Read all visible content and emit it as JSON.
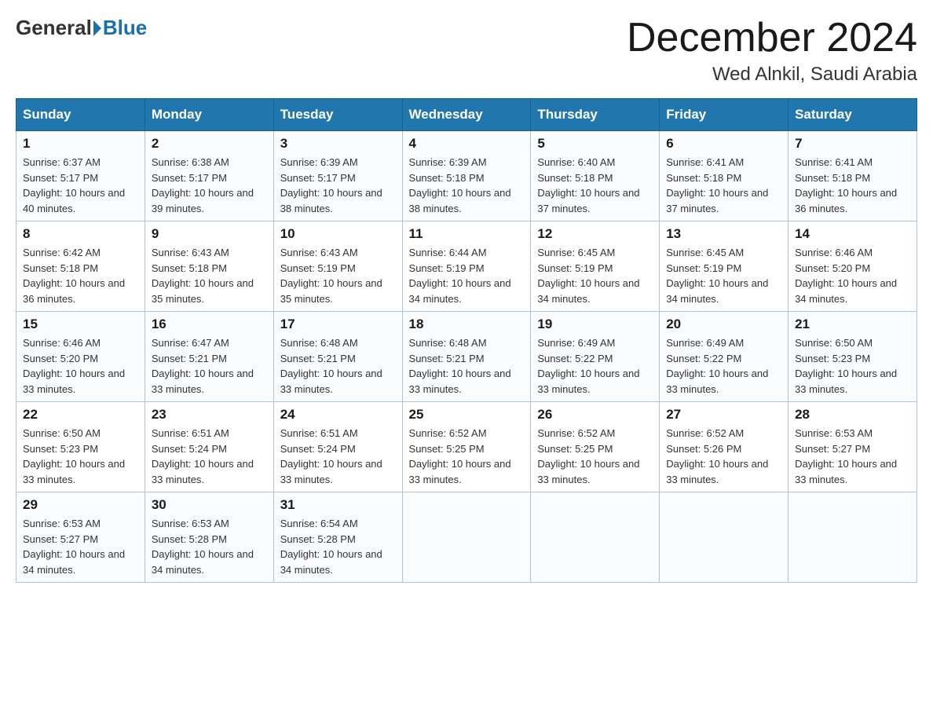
{
  "header": {
    "logo": {
      "part1": "General",
      "part2": "Blue"
    },
    "title": "December 2024",
    "subtitle": "Wed Alnkil, Saudi Arabia"
  },
  "days_of_week": [
    "Sunday",
    "Monday",
    "Tuesday",
    "Wednesday",
    "Thursday",
    "Friday",
    "Saturday"
  ],
  "weeks": [
    [
      {
        "day": "1",
        "sunrise": "6:37 AM",
        "sunset": "5:17 PM",
        "daylight": "10 hours and 40 minutes."
      },
      {
        "day": "2",
        "sunrise": "6:38 AM",
        "sunset": "5:17 PM",
        "daylight": "10 hours and 39 minutes."
      },
      {
        "day": "3",
        "sunrise": "6:39 AM",
        "sunset": "5:17 PM",
        "daylight": "10 hours and 38 minutes."
      },
      {
        "day": "4",
        "sunrise": "6:39 AM",
        "sunset": "5:18 PM",
        "daylight": "10 hours and 38 minutes."
      },
      {
        "day": "5",
        "sunrise": "6:40 AM",
        "sunset": "5:18 PM",
        "daylight": "10 hours and 37 minutes."
      },
      {
        "day": "6",
        "sunrise": "6:41 AM",
        "sunset": "5:18 PM",
        "daylight": "10 hours and 37 minutes."
      },
      {
        "day": "7",
        "sunrise": "6:41 AM",
        "sunset": "5:18 PM",
        "daylight": "10 hours and 36 minutes."
      }
    ],
    [
      {
        "day": "8",
        "sunrise": "6:42 AM",
        "sunset": "5:18 PM",
        "daylight": "10 hours and 36 minutes."
      },
      {
        "day": "9",
        "sunrise": "6:43 AM",
        "sunset": "5:18 PM",
        "daylight": "10 hours and 35 minutes."
      },
      {
        "day": "10",
        "sunrise": "6:43 AM",
        "sunset": "5:19 PM",
        "daylight": "10 hours and 35 minutes."
      },
      {
        "day": "11",
        "sunrise": "6:44 AM",
        "sunset": "5:19 PM",
        "daylight": "10 hours and 34 minutes."
      },
      {
        "day": "12",
        "sunrise": "6:45 AM",
        "sunset": "5:19 PM",
        "daylight": "10 hours and 34 minutes."
      },
      {
        "day": "13",
        "sunrise": "6:45 AM",
        "sunset": "5:19 PM",
        "daylight": "10 hours and 34 minutes."
      },
      {
        "day": "14",
        "sunrise": "6:46 AM",
        "sunset": "5:20 PM",
        "daylight": "10 hours and 34 minutes."
      }
    ],
    [
      {
        "day": "15",
        "sunrise": "6:46 AM",
        "sunset": "5:20 PM",
        "daylight": "10 hours and 33 minutes."
      },
      {
        "day": "16",
        "sunrise": "6:47 AM",
        "sunset": "5:21 PM",
        "daylight": "10 hours and 33 minutes."
      },
      {
        "day": "17",
        "sunrise": "6:48 AM",
        "sunset": "5:21 PM",
        "daylight": "10 hours and 33 minutes."
      },
      {
        "day": "18",
        "sunrise": "6:48 AM",
        "sunset": "5:21 PM",
        "daylight": "10 hours and 33 minutes."
      },
      {
        "day": "19",
        "sunrise": "6:49 AM",
        "sunset": "5:22 PM",
        "daylight": "10 hours and 33 minutes."
      },
      {
        "day": "20",
        "sunrise": "6:49 AM",
        "sunset": "5:22 PM",
        "daylight": "10 hours and 33 minutes."
      },
      {
        "day": "21",
        "sunrise": "6:50 AM",
        "sunset": "5:23 PM",
        "daylight": "10 hours and 33 minutes."
      }
    ],
    [
      {
        "day": "22",
        "sunrise": "6:50 AM",
        "sunset": "5:23 PM",
        "daylight": "10 hours and 33 minutes."
      },
      {
        "day": "23",
        "sunrise": "6:51 AM",
        "sunset": "5:24 PM",
        "daylight": "10 hours and 33 minutes."
      },
      {
        "day": "24",
        "sunrise": "6:51 AM",
        "sunset": "5:24 PM",
        "daylight": "10 hours and 33 minutes."
      },
      {
        "day": "25",
        "sunrise": "6:52 AM",
        "sunset": "5:25 PM",
        "daylight": "10 hours and 33 minutes."
      },
      {
        "day": "26",
        "sunrise": "6:52 AM",
        "sunset": "5:25 PM",
        "daylight": "10 hours and 33 minutes."
      },
      {
        "day": "27",
        "sunrise": "6:52 AM",
        "sunset": "5:26 PM",
        "daylight": "10 hours and 33 minutes."
      },
      {
        "day": "28",
        "sunrise": "6:53 AM",
        "sunset": "5:27 PM",
        "daylight": "10 hours and 33 minutes."
      }
    ],
    [
      {
        "day": "29",
        "sunrise": "6:53 AM",
        "sunset": "5:27 PM",
        "daylight": "10 hours and 34 minutes."
      },
      {
        "day": "30",
        "sunrise": "6:53 AM",
        "sunset": "5:28 PM",
        "daylight": "10 hours and 34 minutes."
      },
      {
        "day": "31",
        "sunrise": "6:54 AM",
        "sunset": "5:28 PM",
        "daylight": "10 hours and 34 minutes."
      },
      null,
      null,
      null,
      null
    ]
  ]
}
